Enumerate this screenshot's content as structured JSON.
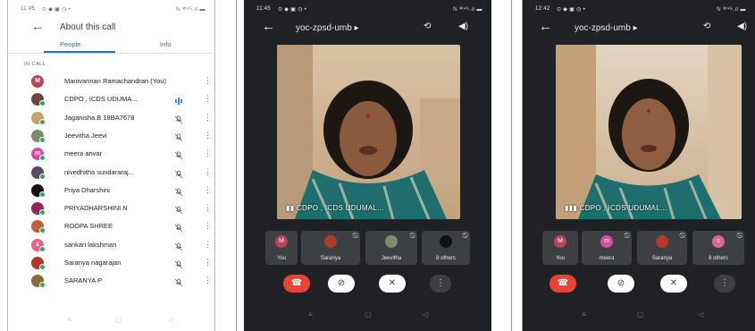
{
  "panel1": {
    "status_time": "11:45",
    "status_icons": "⊙ ◆ ▣ ◷ •",
    "status_right": "ℕ ᵂ⁴ᴳ.ıl ▬",
    "title": "About this call",
    "tabs": [
      "People",
      "Info"
    ],
    "section_label": "IN CALL",
    "participants": [
      {
        "name": "Manivannan Ramachandran (You)",
        "initial": "M",
        "color": "#b7465a",
        "mic": "none"
      },
      {
        "name": "CDPO , ICDS UDUMA...",
        "initial": "",
        "color": "#6b4a3a",
        "mic": "speaking"
      },
      {
        "name": "Jaganisha.B 18BA7678",
        "initial": "",
        "color": "#c6a06e",
        "mic": "muted"
      },
      {
        "name": "Jeevitha Jeevi",
        "initial": "",
        "color": "#7a8c6a",
        "mic": "muted"
      },
      {
        "name": "meera anvar",
        "initial": "m",
        "color": "#d64ea0",
        "mic": "muted"
      },
      {
        "name": "nivedhitha sundararaj...",
        "initial": "",
        "color": "#5a4a6a",
        "mic": "muted"
      },
      {
        "name": "Priya Dharshini",
        "initial": "",
        "color": "#111111",
        "mic": "muted"
      },
      {
        "name": "PRIYADHARSHINI N",
        "initial": "",
        "color": "#8a2a5a",
        "mic": "muted"
      },
      {
        "name": "ROOPA SHREE",
        "initial": "",
        "color": "#c0603a",
        "mic": "muted"
      },
      {
        "name": "sankari lakshman",
        "initial": "s",
        "color": "#e0648e",
        "mic": "muted"
      },
      {
        "name": "Saranya nagarajan",
        "initial": "",
        "color": "#b03a2a",
        "mic": "muted"
      },
      {
        "name": "SARANYA P",
        "initial": "",
        "color": "#8a6a3a",
        "mic": "muted"
      }
    ]
  },
  "panel2": {
    "status_time": "11:45",
    "status_icons": "⊙ ◆ ▣ ◷ •",
    "status_right": "ℕ ᵂ⁴ᴳ.ıl ▬",
    "meeting_code": "yoc-zpsd-umb ▸",
    "video_label": "CDPO , ICDS UDUMAL...",
    "tiles": [
      {
        "label": "You",
        "initial": "M",
        "color": "#b7465a"
      },
      {
        "label": "Saranya",
        "initial": "",
        "color": "#b03a2a"
      },
      {
        "label": "Jeevitha",
        "initial": "",
        "color": "#7a8c6a"
      },
      {
        "label": "8 others",
        "initial": "",
        "color": "#111111"
      }
    ]
  },
  "panel3": {
    "status_time": "12:42",
    "status_icons": "⊙ ◆ ▣ ◷ •",
    "status_right": "ℕ ᵂ⁴ᴳ.ıl ▬",
    "meeting_code": "yoc-zpsd-umb ▸",
    "video_label": "CDPO , ICDS UDUMAL...",
    "tiles": [
      {
        "label": "You",
        "initial": "M",
        "color": "#b7465a"
      },
      {
        "label": "meera",
        "initial": "m",
        "color": "#d64ea0"
      },
      {
        "label": "Saranya",
        "initial": "",
        "color": "#b03a2a"
      },
      {
        "label": "8 others",
        "initial": "s",
        "color": "#e0648e"
      }
    ]
  },
  "colors": {
    "accent": "#1a73e8",
    "end_call": "#ea4335",
    "speaking": "#4285f4",
    "online": "#34a853"
  }
}
